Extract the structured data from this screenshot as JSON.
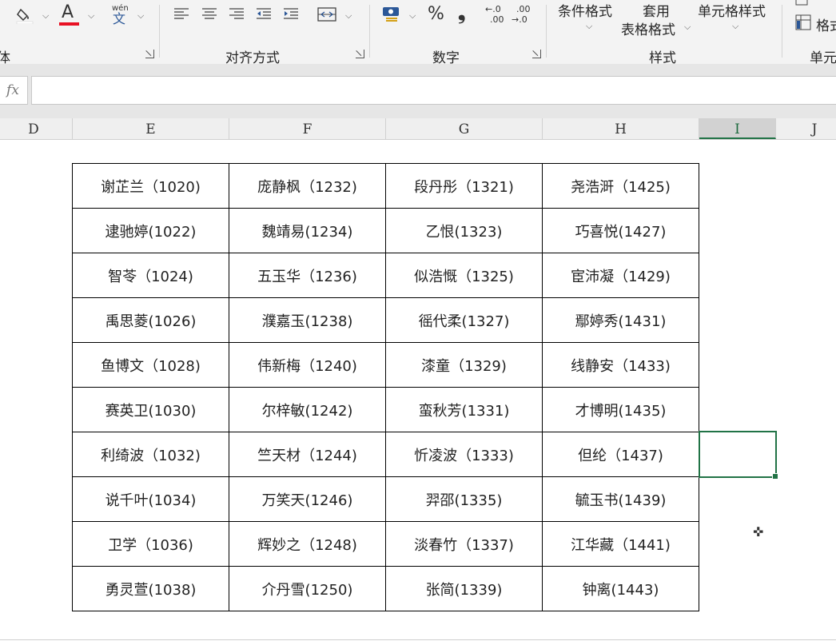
{
  "ribbon": {
    "groups": [
      {
        "name": "font_partial",
        "label": "体"
      },
      {
        "name": "alignment",
        "label": "对齐方式"
      },
      {
        "name": "number",
        "label": "数字"
      },
      {
        "name": "styles",
        "label": "样式"
      },
      {
        "name": "cells_partial",
        "label": "单元"
      }
    ],
    "font_glyph": "A",
    "phonetic_glyph": "文",
    "phonetic_pinyin": "wén",
    "percent_glyph": "%",
    "comma_glyph": "❟",
    "increase_decimal_top": "←.0",
    "increase_decimal_bottom": ".00",
    "decrease_decimal_top": ".00",
    "decrease_decimal_bottom": "→.0",
    "conditional_format": "条件格式",
    "table_format_line1": "套用",
    "table_format_line2": "表格格式",
    "cell_styles": "单元格样式",
    "format_partial": "格式",
    "colors": {
      "font_red": "#e81123",
      "accent_green": "#217346"
    }
  },
  "formula_bar": {
    "fx": "fx",
    "value": ""
  },
  "columns": [
    {
      "label": "D",
      "selected": false
    },
    {
      "label": "E",
      "selected": false
    },
    {
      "label": "F",
      "selected": false
    },
    {
      "label": "G",
      "selected": false
    },
    {
      "label": "H",
      "selected": false
    },
    {
      "label": "I",
      "selected": true
    },
    {
      "label": "J",
      "selected": false
    }
  ],
  "table": {
    "rows": [
      [
        "谢芷兰（1020)",
        "庞静枫（1232)",
        "段丹彤（1321)",
        "尧浩涆（1425)"
      ],
      [
        "逮驰婷(1022)",
        "魏靖易(1234)",
        "乙恨(1323)",
        "巧喜悦(1427)"
      ],
      [
        "智苓（1024)",
        "五玉华（1236)",
        "似浩慨（1325)",
        "宦沛凝（1429)"
      ],
      [
        "禹思菱(1026)",
        "濮嘉玉(1238)",
        "徭代柔(1327)",
        "鄢婷秀(1431)"
      ],
      [
        "鱼博文（1028)",
        "伟新梅（1240)",
        "漆童（1329)",
        "线静安（1433)"
      ],
      [
        "赛英卫(1030)",
        "尔梓敏(1242)",
        "蛮秋芳(1331)",
        "才博明(1435)"
      ],
      [
        "利绮波（1032)",
        "竺天材（1244)",
        "忻凌波（1333)",
        "但纶（1437)"
      ],
      [
        "说千叶(1034)",
        "万笑天(1246)",
        "羿邵(1335)",
        "毓玉书(1439)"
      ],
      [
        "卫学（1036)",
        "辉妙之（1248)",
        "淡春竹（1337)",
        "江华藏（1441)"
      ],
      [
        "勇灵萱(1038)",
        "介丹雪(1250)",
        "张简(1339)",
        "钟离(1443)"
      ]
    ]
  }
}
